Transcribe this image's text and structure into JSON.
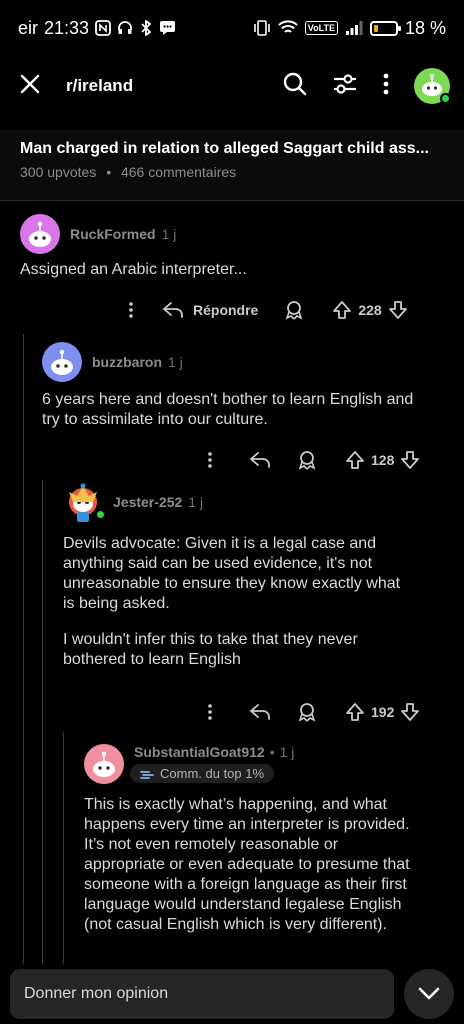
{
  "status_bar": {
    "carrier": "eir",
    "time": "21:33",
    "battery_percent": "18 %",
    "battery_level": 0.18,
    "network_label": "VoLTE"
  },
  "app_bar": {
    "subreddit": "r/ireland",
    "icons": [
      "close-icon",
      "search-icon",
      "filter-icon",
      "more-vert-icon",
      "avatar"
    ]
  },
  "post": {
    "title": "Man charged in relation to alleged Saggart child ass...",
    "upvotes": "300 upvotes",
    "separator": "•",
    "comments": "466 commentaires"
  },
  "comments": [
    {
      "username": "RuckFormed",
      "age": "1 j",
      "body": [
        "Assigned an Arabic interpreter..."
      ],
      "reply_label": "Répondre",
      "score": "228",
      "avatar_color": "#d977e8"
    },
    {
      "username": "buzzbaron",
      "age": "1 j",
      "body": [
        "6 years here and doesn't bother to learn English and",
        "try to assimilate into our culture."
      ],
      "score": "128",
      "avatar_color": "#7e8ff0"
    },
    {
      "username": "Jester-252",
      "age": "1 j",
      "body": [
        "Devils advocate: Given it is a legal case and",
        "anything said can be used evidence, it's not",
        "unreasonable to ensure they know exactly what",
        "is being asked.",
        "",
        "I wouldn't infer this to take that they never",
        "bothered to learn English"
      ],
      "score": "192",
      "avatar_color": "#e85a3c"
    },
    {
      "username": "SubstantialGoat912",
      "separator": "•",
      "age": "1 j",
      "badge": "Comm. du top 1%",
      "body": [
        "This is exactly what’s happening, and what",
        "happens every time an interpreter is provided.",
        "It’s not even remotely reasonable or",
        "appropriate or even adequate to presume that",
        "someone with a foreign language as their first",
        "language would understand legalese English",
        "(not casual English which is very different)."
      ],
      "avatar_color": "#f08fa0"
    }
  ],
  "bottom": {
    "reply_placeholder": "Donner mon opinion"
  }
}
